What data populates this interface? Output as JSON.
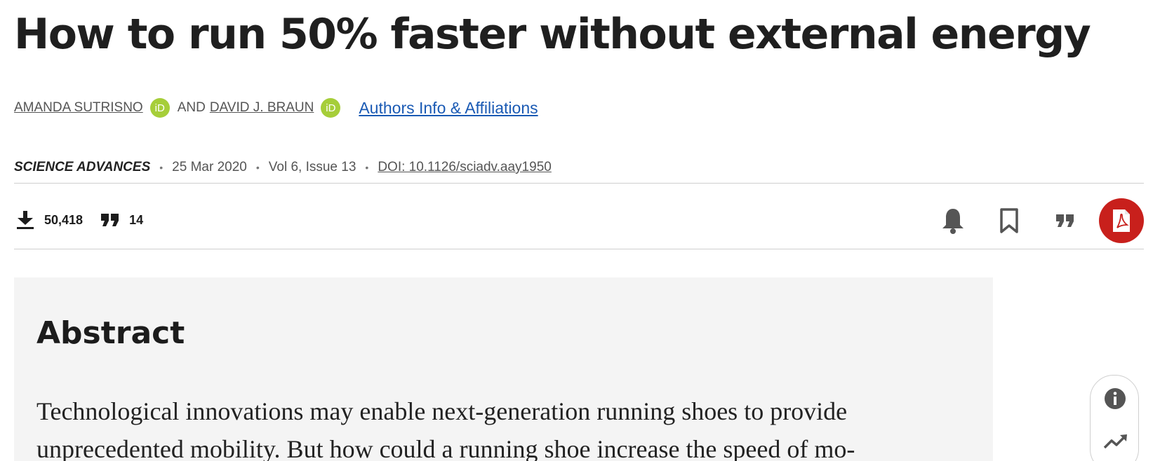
{
  "article": {
    "title": "How to run 50% faster without external energy"
  },
  "authors": {
    "items": [
      {
        "name": "AMANDA SUTRISNO",
        "orcid_badge": "iD"
      },
      {
        "name": "DAVID J. BRAUN",
        "orcid_badge": "iD"
      }
    ],
    "conjunction": "AND",
    "affiliations_link": "Authors Info & Affiliations"
  },
  "meta": {
    "journal": "SCIENCE ADVANCES",
    "date": "25 Mar 2020",
    "volume_issue": "Vol 6, Issue 13",
    "doi": "DOI: 10.1126/sciadv.aay1950",
    "separator": "•"
  },
  "stats": {
    "downloads": "50,418",
    "citations": "14",
    "download_icon": "download-icon",
    "citation_icon": "quote-icon"
  },
  "toolbar": {
    "icons": [
      "bell-icon",
      "bookmark-icon",
      "quote-icon",
      "pdf-icon"
    ],
    "pdf_color": "#c8201c"
  },
  "abstract": {
    "heading": "Abstract",
    "text": "Technological innovations may enable next-generation running shoes to provide unprecedented mobility. But how could a running shoe increase the speed of mo-"
  },
  "side_rail": {
    "icons": [
      "info-icon",
      "trending-icon"
    ]
  },
  "colors": {
    "orcid_green": "#a6ce39",
    "link_blue": "#1a5ab4",
    "abstract_bg": "#f4f4f4"
  }
}
